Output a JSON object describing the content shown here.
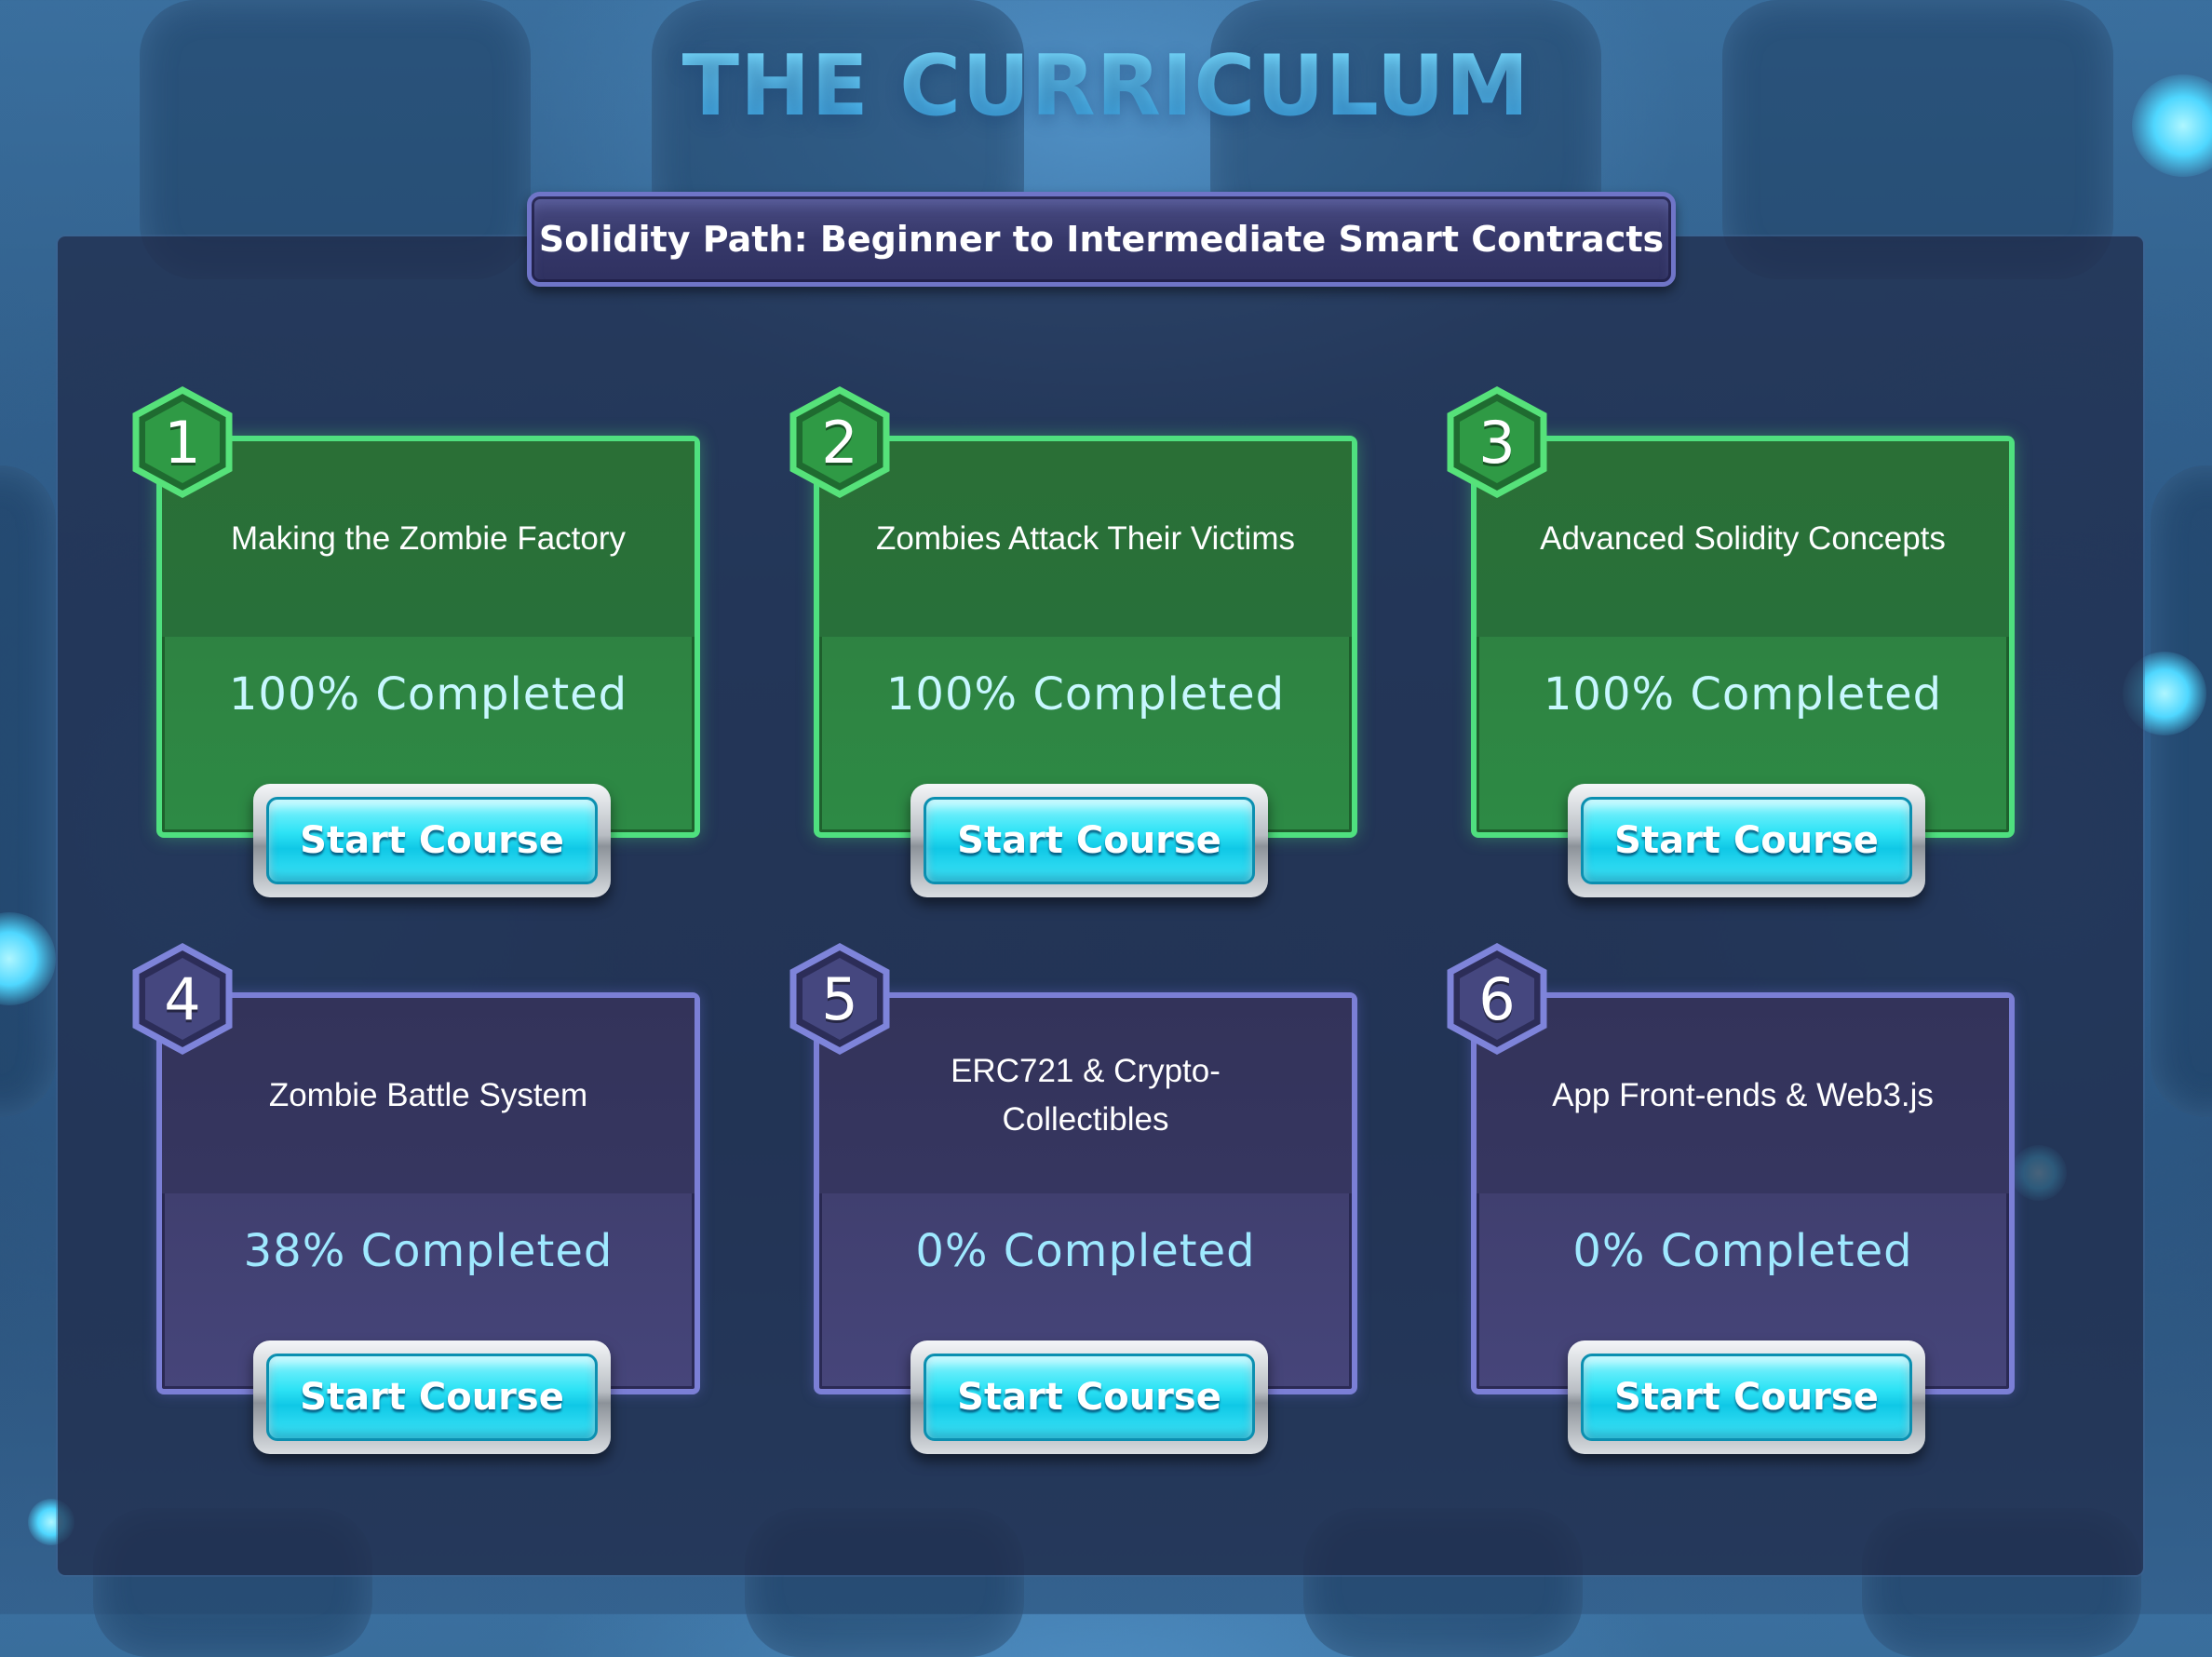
{
  "header": {
    "title": "THE CURRICULUM"
  },
  "path": {
    "subtitle": "Solidity Path: Beginner to Intermediate Smart Contracts"
  },
  "courses": [
    {
      "number": "1",
      "title": "Making the Zombie Factory",
      "progress_text": "100% Completed",
      "progress": 100,
      "state": "completed",
      "button_label": "Start Course"
    },
    {
      "number": "2",
      "title": "Zombies Attack Their Victims",
      "progress_text": "100% Completed",
      "progress": 100,
      "state": "completed",
      "button_label": "Start Course"
    },
    {
      "number": "3",
      "title": "Advanced Solidity Concepts",
      "progress_text": "100% Completed",
      "progress": 100,
      "state": "completed",
      "button_label": "Start Course"
    },
    {
      "number": "4",
      "title": "Zombie Battle System",
      "progress_text": "38% Completed",
      "progress": 38,
      "state": "in-progress",
      "button_label": "Start Course"
    },
    {
      "number": "5",
      "title": "ERC721 & Crypto-Collectibles",
      "progress_text": "0% Completed",
      "progress": 0,
      "state": "not-started",
      "button_label": "Start Course"
    },
    {
      "number": "6",
      "title": "App Front-ends & Web3.js",
      "progress_text": "0% Completed",
      "progress": 0,
      "state": "not-started",
      "button_label": "Start Course"
    }
  ],
  "colors": {
    "completed_accent": "#4fe07f",
    "incomplete_accent": "#7b7fd6",
    "button_accent": "#2ee3f5",
    "title_color": "#52c8f5"
  }
}
